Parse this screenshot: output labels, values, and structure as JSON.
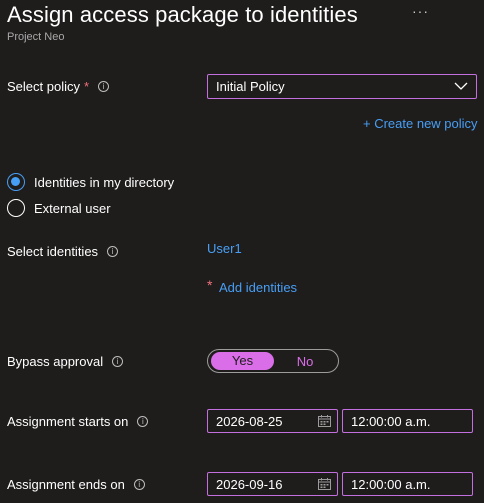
{
  "header": {
    "title": "Assign access package to identities",
    "more": "···",
    "subtitle": "Project Neo"
  },
  "policy": {
    "label": "Select policy",
    "required": "*",
    "value": "Initial Policy",
    "create_link": "+ Create new policy"
  },
  "identity_type": {
    "options": [
      "Identities in my directory",
      "External user"
    ],
    "selected": "Identities in my directory"
  },
  "identities": {
    "label": "Select identities",
    "selected_user": "User1",
    "required": "*",
    "add_link": "Add identities"
  },
  "bypass": {
    "label": "Bypass approval",
    "yes": "Yes",
    "no": "No",
    "value": "Yes"
  },
  "start": {
    "label": "Assignment starts on",
    "date": "2026-08-25",
    "time": "12:00:00 a.m."
  },
  "end": {
    "label": "Assignment ends on",
    "date": "2026-09-16",
    "time": "12:00:00 a.m."
  },
  "colors": {
    "accent": "#c46fe0",
    "link": "#479ef5",
    "required": "#f1707b",
    "background": "#1f1d1c"
  }
}
